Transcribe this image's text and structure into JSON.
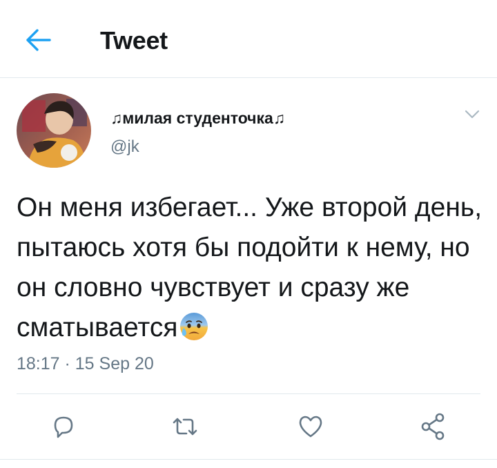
{
  "header": {
    "title": "Tweet"
  },
  "tweet": {
    "author_name": "♫милая студенточка♫",
    "author_handle": "@jk",
    "text": "Он меня избегает... Уже второй день, пытаюсь хотя бы подойти к нему, но он словно чувствует и сразу же сматывается",
    "timestamp": "18:17 · 15 Sep 20",
    "emoji": "anxious-face-with-sweat"
  },
  "colors": {
    "accent": "#1da1f2",
    "secondary_text": "#657786",
    "icon": "#657786",
    "divider": "#e1e8ed"
  },
  "icons": {
    "back": "arrow-left-icon",
    "more": "chevron-down-icon",
    "reply": "reply-icon",
    "retweet": "retweet-icon",
    "like": "heart-icon",
    "share": "share-icon"
  }
}
